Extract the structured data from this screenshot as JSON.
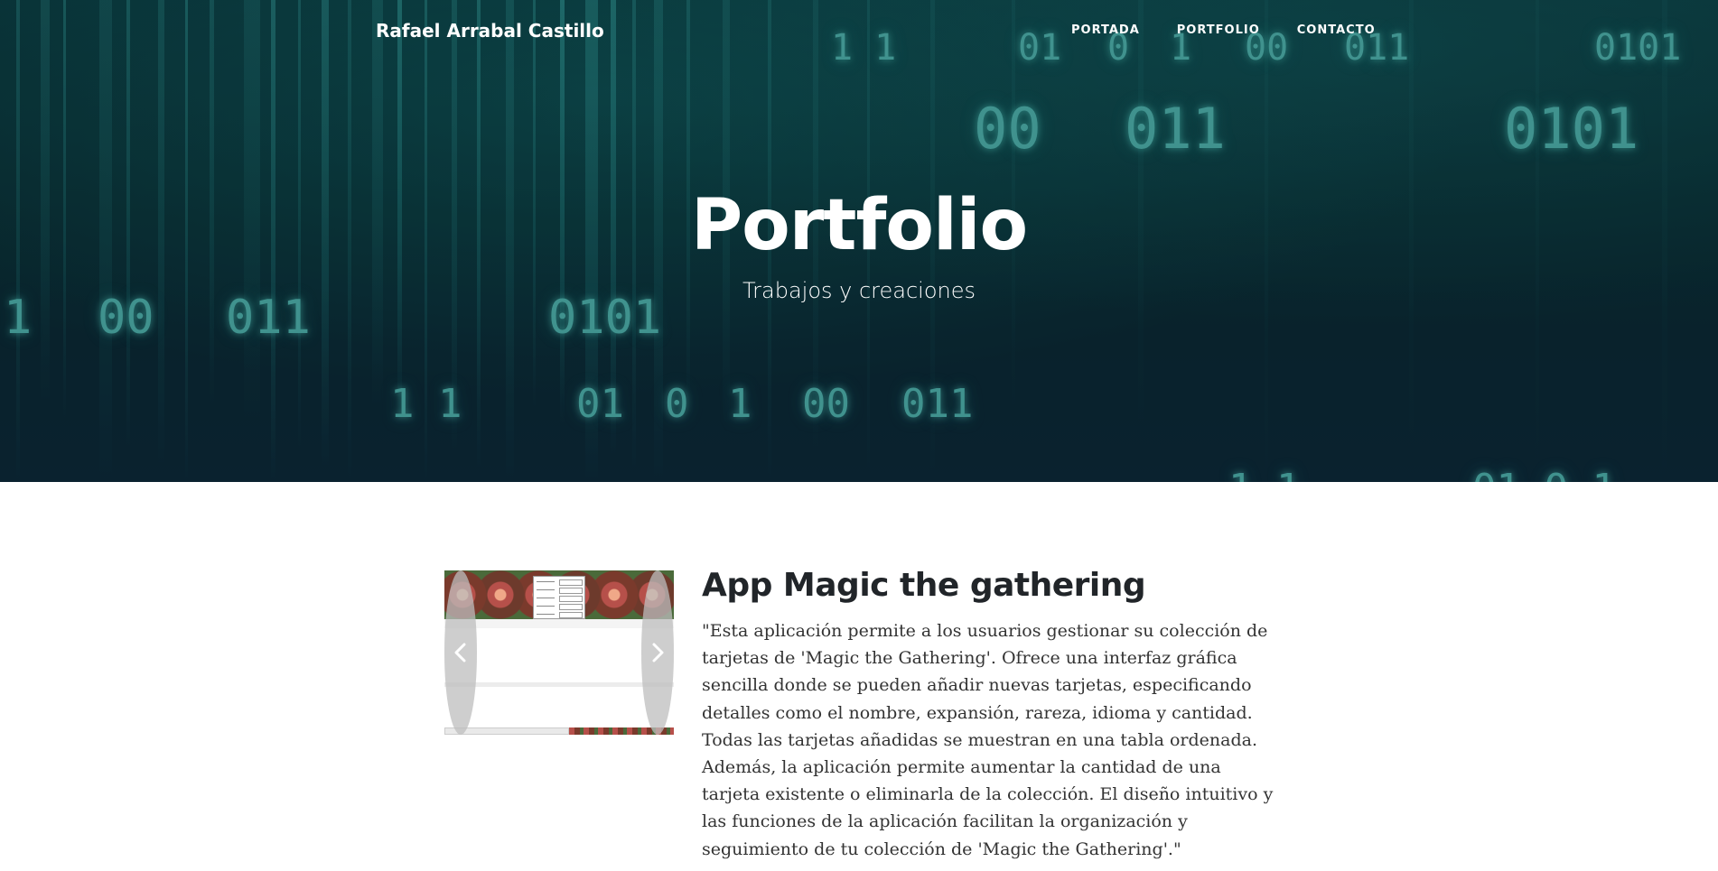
{
  "nav": {
    "brand": "Rafael Arrabal Castillo",
    "links": [
      {
        "label": "PORTADA"
      },
      {
        "label": "PORTFOLIO"
      },
      {
        "label": "CONTACTO"
      }
    ]
  },
  "hero": {
    "title": "Portfolio",
    "subtitle": "Trabajos y creaciones",
    "background_digits": [
      "1 1",
      "01",
      "0",
      "1",
      "00",
      "011",
      "0101",
      "00",
      "011",
      "0101",
      "1",
      "00",
      "011",
      "0101",
      "1 1",
      "01",
      "0",
      "1",
      "00",
      "011",
      "1 1",
      "01 0 1"
    ]
  },
  "project": {
    "title": "App Magic the gathering",
    "description": "\"Esta aplicación permite a los usuarios gestionar su colección de tarjetas de 'Magic the Gathering'. Ofrece una interfaz gráfica sencilla donde se pueden añadir nuevas tarjetas, especificando detalles como el nombre, expansión, rareza, idioma y cantidad. Todas las tarjetas añadidas se muestran en una tabla ordenada. Además, la aplicación permite aumentar la cantidad de una tarjeta existente o eliminarla de la colección. El diseño intuitivo y las funciones de la aplicación facilitan la organización y seguimiento de tu colección de 'Magic the Gathering'.\"",
    "carousel": {
      "prev_icon": "chevron-left-icon",
      "next_icon": "chevron-right-icon"
    }
  },
  "colors": {
    "hero_bg": "#0b3a40",
    "digit_glow": "#4fb3ae",
    "text_dark": "#212529",
    "body_text": "#333333"
  }
}
